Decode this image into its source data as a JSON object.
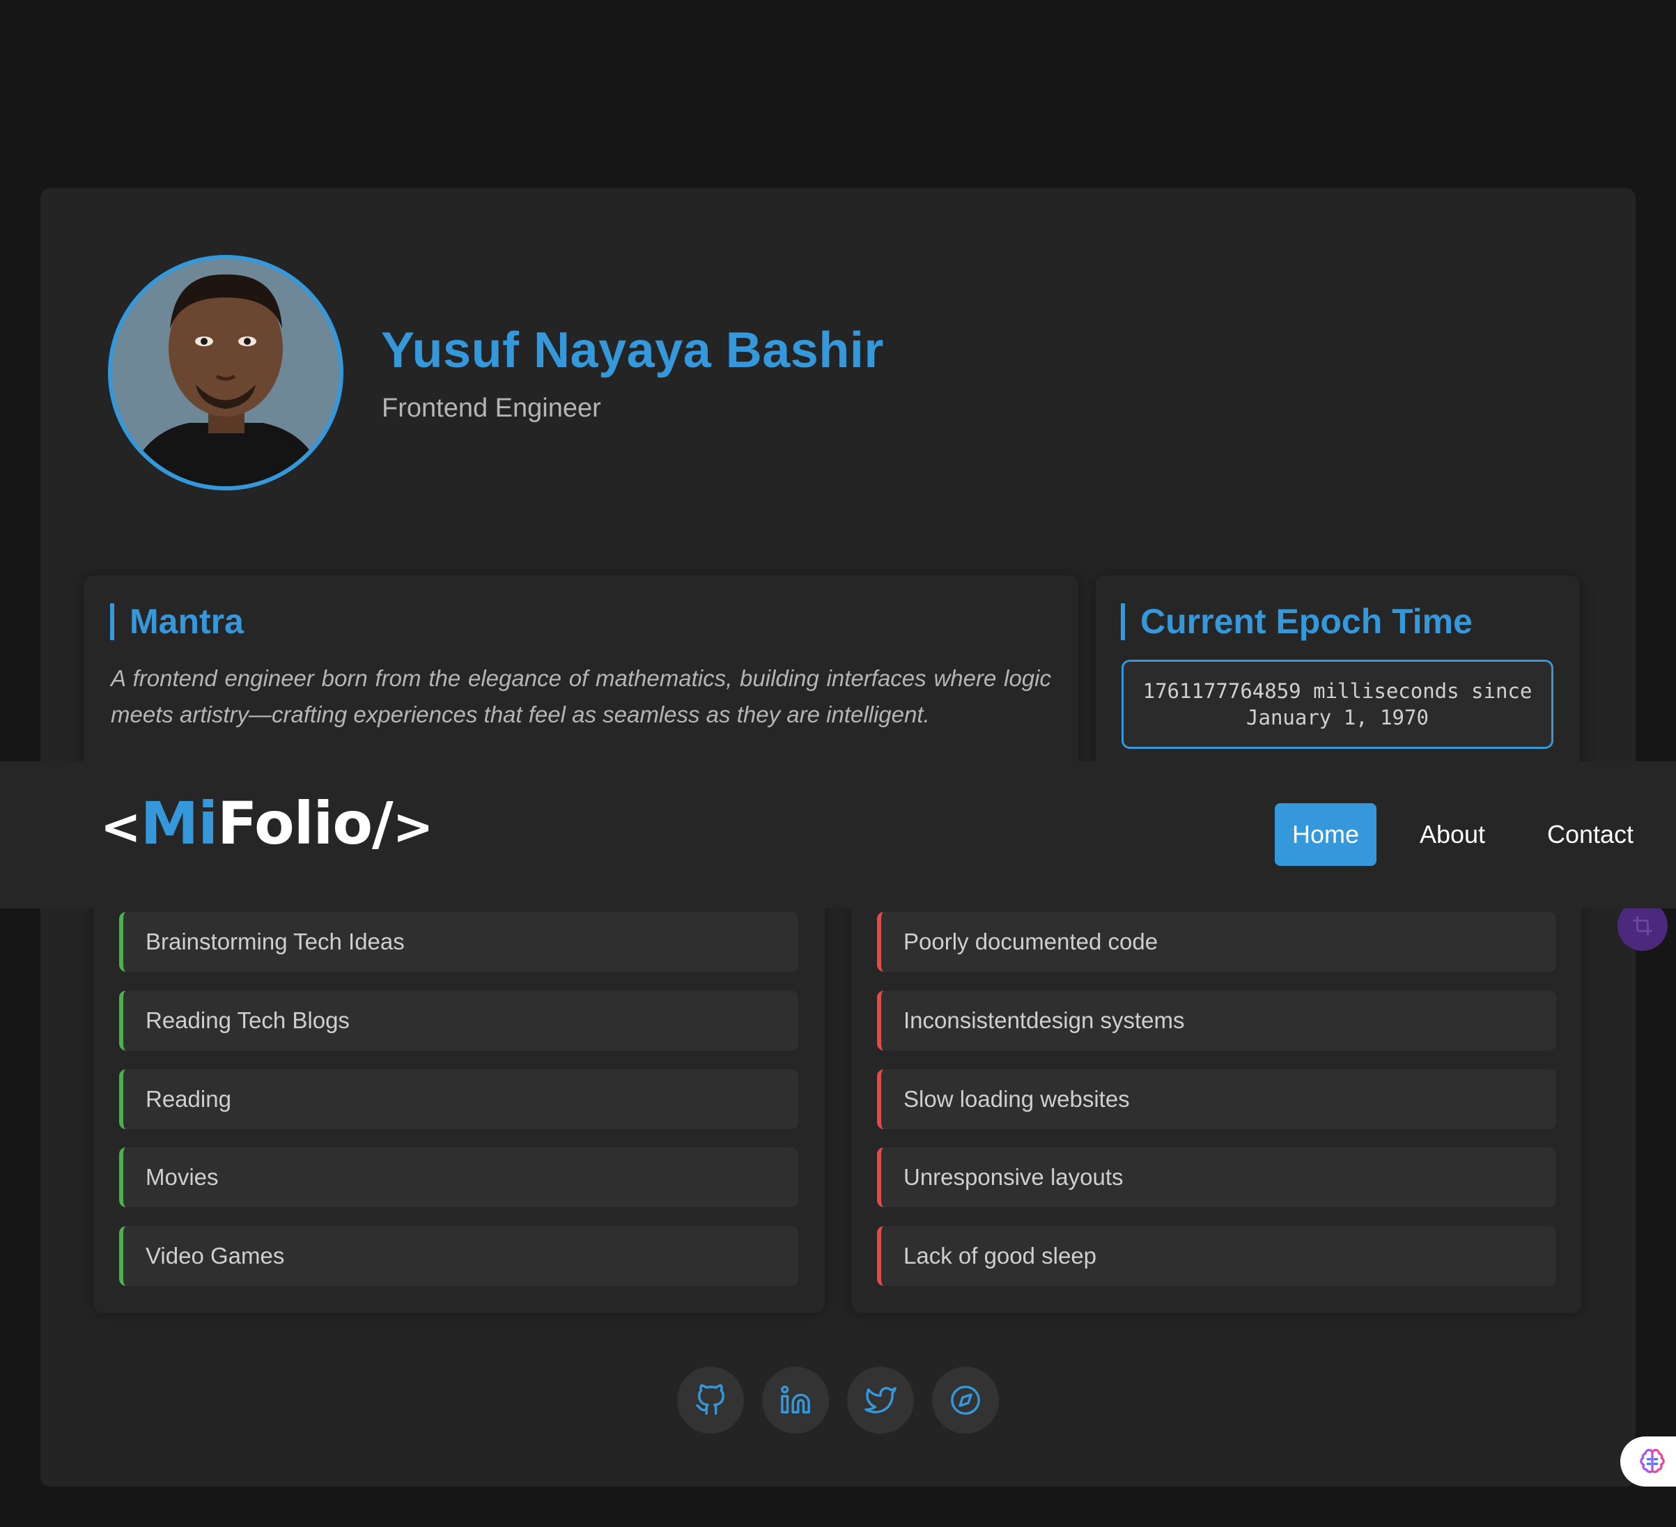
{
  "profile": {
    "name": "Yusuf Nayaya Bashir",
    "role": "Frontend Engineer",
    "avatar_icon": "profile-photo"
  },
  "mantra": {
    "title": "Mantra",
    "text": "A frontend engineer born from the elegance of mathematics, building interfaces where logic meets artistry—crafting experiences that feel as seamless as they are intelligent."
  },
  "epoch": {
    "title": "Current Epoch Time",
    "value_line1": "1761177764859 milliseconds since",
    "value_line2": "January 1, 1970"
  },
  "navbar": {
    "logo_open": "<",
    "logo_accent": "Mi",
    "logo_rest": "Folio/",
    "logo_close": ">",
    "links": [
      {
        "label": "Home",
        "active": true
      },
      {
        "label": "About",
        "active": false
      },
      {
        "label": "Contact",
        "active": false
      }
    ]
  },
  "likes": {
    "accent_color": "#4caf50",
    "items": [
      "Brainstorming Tech Ideas",
      "Reading Tech Blogs",
      "Reading",
      "Movies",
      "Video Games"
    ]
  },
  "dislikes": {
    "accent_color": "#e04b4b",
    "items": [
      "Poorly documented code",
      "Inconsistentdesign systems",
      "Slow loading websites",
      "Unresponsive layouts",
      "Lack of good sleep"
    ]
  },
  "socials": [
    {
      "icon": "github-icon"
    },
    {
      "icon": "linkedin-icon"
    },
    {
      "icon": "twitter-icon"
    },
    {
      "icon": "compass-icon"
    }
  ],
  "colors": {
    "accent": "#3498db",
    "background": "#161616",
    "card": "#242424"
  }
}
